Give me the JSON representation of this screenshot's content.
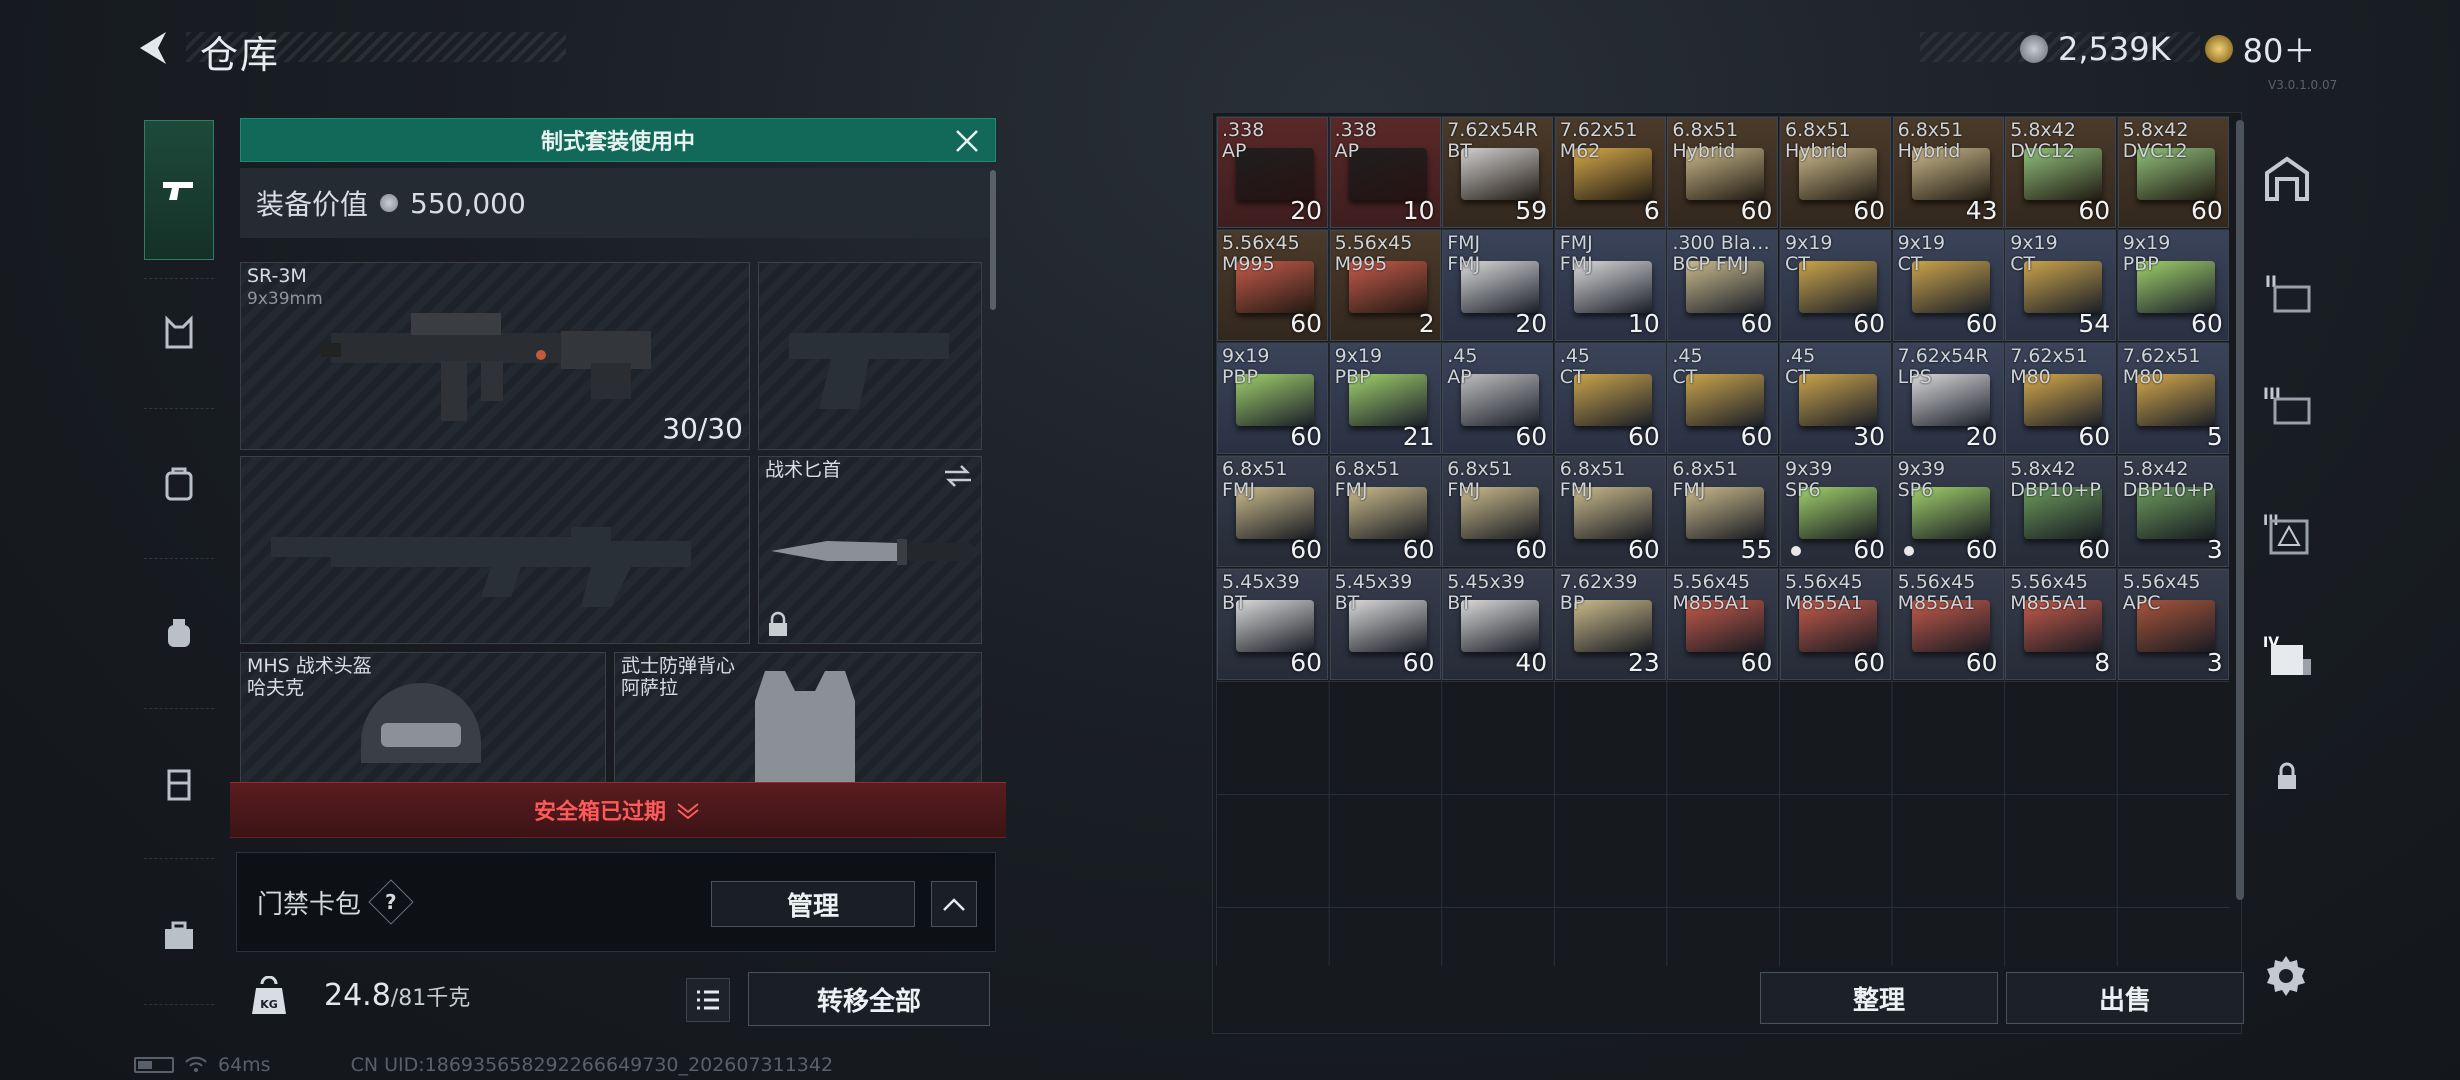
{
  "header": {
    "title": "仓库"
  },
  "currency": {
    "silver": "2,539K",
    "gold": "80＋"
  },
  "version": "V3.0.1.0.07",
  "loadout": {
    "banner": "制式套装使用中",
    "value_label": "装备价值",
    "value": "550,000",
    "primary": {
      "name": "SR-3M",
      "caliber": "9x39mm",
      "ammo": "30/30"
    },
    "knife": {
      "name": "战术匕首"
    },
    "helmet": {
      "name": "MHS 战术头盔",
      "sub": "哈夫克"
    },
    "armor": {
      "name": "武士防弹背心",
      "sub": "阿萨拉"
    },
    "safebox": "安全箱已过期",
    "keycard": {
      "label": "门禁卡包",
      "help": "?",
      "manage": "管理"
    },
    "weight": {
      "current": "24.8",
      "max": "/81千克"
    },
    "transfer_all": "转移全部"
  },
  "storage": {
    "sort": "整理",
    "sell": "出售",
    "items": [
      {
        "name": ".338\nAP",
        "count": "20",
        "color": "red",
        "box": "#1e1e1e"
      },
      {
        "name": ".338\nAP",
        "count": "10",
        "color": "red",
        "box": "#1e1e1e"
      },
      {
        "name": "7.62x54R\nBT",
        "count": "59",
        "color": "brown",
        "box": "#cfcfcf"
      },
      {
        "name": "7.62x51\nM62",
        "count": "6",
        "color": "brown",
        "box": "#d4a84a"
      },
      {
        "name": "6.8x51\nHybrid",
        "count": "60",
        "color": "brown",
        "box": "#c9b98a"
      },
      {
        "name": "6.8x51\nHybrid",
        "count": "60",
        "color": "brown",
        "box": "#c9b98a"
      },
      {
        "name": "6.8x51\nHybrid",
        "count": "43",
        "color": "brown",
        "box": "#c9b98a"
      },
      {
        "name": "5.8x42\nDVC12",
        "count": "60",
        "color": "brown",
        "box": "#8fc07a"
      },
      {
        "name": "5.8x42\nDVC12",
        "count": "60",
        "color": "brown",
        "box": "#8fc07a"
      },
      {
        "name": "5.56x45\nM995",
        "count": "60",
        "color": "brown",
        "box": "#c45a4a"
      },
      {
        "name": "5.56x45\nM995",
        "count": "2",
        "color": "brown",
        "box": "#c45a4a"
      },
      {
        "name": "FMJ\nFMJ",
        "count": "20",
        "color": "blue",
        "box": "#d8d8d8"
      },
      {
        "name": "FMJ\nFMJ",
        "count": "10",
        "color": "blue",
        "box": "#d8d8d8"
      },
      {
        "name": ".300 Bla…\nBCP FMJ",
        "count": "60",
        "color": "blue",
        "box": "#c9b98a"
      },
      {
        "name": "9x19\nCT",
        "count": "60",
        "color": "blue",
        "box": "#c9a34a"
      },
      {
        "name": "9x19\nCT",
        "count": "60",
        "color": "blue",
        "box": "#c9a34a"
      },
      {
        "name": "9x19\nCT",
        "count": "54",
        "color": "blue",
        "box": "#c9a34a"
      },
      {
        "name": "9x19\nPBP",
        "count": "60",
        "color": "blue",
        "box": "#9fcf6a"
      },
      {
        "name": "9x19\nPBP",
        "count": "60",
        "color": "blue",
        "box": "#9fcf6a"
      },
      {
        "name": "9x19\nPBP",
        "count": "21",
        "color": "blue",
        "box": "#9fcf6a"
      },
      {
        "name": ".45\nAP",
        "count": "60",
        "color": "blue",
        "box": "#bdbdbd"
      },
      {
        "name": ".45\nCT",
        "count": "60",
        "color": "blue",
        "box": "#c9a34a"
      },
      {
        "name": ".45\nCT",
        "count": "60",
        "color": "blue",
        "box": "#c9a34a"
      },
      {
        "name": ".45\nCT",
        "count": "30",
        "color": "blue",
        "box": "#c9a34a"
      },
      {
        "name": "7.62x54R\nLPS",
        "count": "20",
        "color": "blue",
        "box": "#d8d8d8"
      },
      {
        "name": "7.62x51\nM80",
        "count": "60",
        "color": "blue",
        "box": "#d4a84a"
      },
      {
        "name": "7.62x51\nM80",
        "count": "5",
        "color": "blue",
        "box": "#d4a84a"
      },
      {
        "name": "6.8x51\nFMJ",
        "count": "60",
        "color": "slate",
        "box": "#c9b98a"
      },
      {
        "name": "6.8x51\nFMJ",
        "count": "60",
        "color": "slate",
        "box": "#c9b98a"
      },
      {
        "name": "6.8x51\nFMJ",
        "count": "60",
        "color": "slate",
        "box": "#c9b98a"
      },
      {
        "name": "6.8x51\nFMJ",
        "count": "60",
        "color": "slate",
        "box": "#c9b98a"
      },
      {
        "name": "6.8x51\nFMJ",
        "count": "55",
        "color": "slate",
        "box": "#c9b98a"
      },
      {
        "name": "9x39\nSP6",
        "count": "60",
        "color": "slate",
        "box": "#9fcf6a",
        "dot": true
      },
      {
        "name": "9x39\nSP6",
        "count": "60",
        "color": "slate",
        "box": "#9fcf6a",
        "dot": true
      },
      {
        "name": "5.8x42\nDBP10+P",
        "count": "60",
        "color": "slate",
        "box": "#6a9a5a"
      },
      {
        "name": "5.8x42\nDBP10+P",
        "count": "3",
        "color": "slate",
        "box": "#6a9a5a"
      },
      {
        "name": "5.45x39\nBT",
        "count": "60",
        "color": "slate",
        "box": "#d8d8d8"
      },
      {
        "name": "5.45x39\nBT",
        "count": "60",
        "color": "slate",
        "box": "#d8d8d8"
      },
      {
        "name": "5.45x39\nBT",
        "count": "40",
        "color": "slate",
        "box": "#d8d8d8"
      },
      {
        "name": "7.62x39\nBP",
        "count": "23",
        "color": "slate",
        "box": "#c9b98a"
      },
      {
        "name": "5.56x45\nM855A1",
        "count": "60",
        "color": "slate",
        "box": "#c45a4a"
      },
      {
        "name": "5.56x45\nM855A1",
        "count": "60",
        "color": "slate",
        "box": "#c45a4a"
      },
      {
        "name": "5.56x45\nM855A1",
        "count": "60",
        "color": "slate",
        "box": "#c45a4a"
      },
      {
        "name": "5.56x45\nM855A1",
        "count": "8",
        "color": "slate",
        "box": "#c45a4a"
      },
      {
        "name": "5.56x45\nAPC",
        "count": "3",
        "color": "slate",
        "box": "#a8553a"
      }
    ]
  },
  "status": {
    "ping": "64ms",
    "uid": "CN UID:18693565829226664973​0_202607311342"
  }
}
